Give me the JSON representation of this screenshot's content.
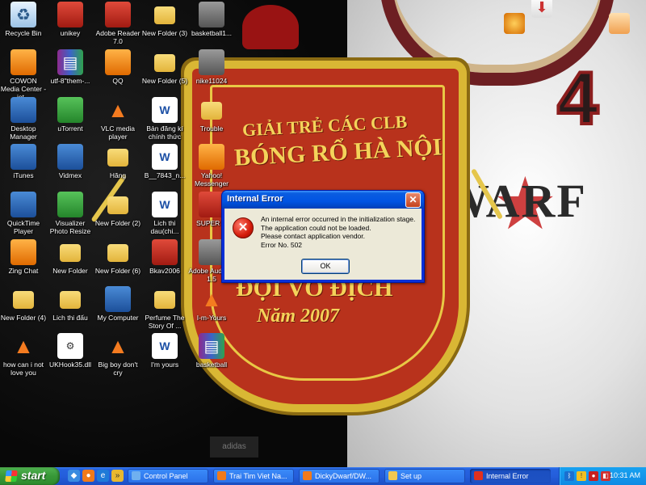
{
  "desktop_icons": [
    {
      "label": "Recycle Bin",
      "icon": "recycle-bin-icon"
    },
    {
      "label": "unikey",
      "icon": "unikey-icon"
    },
    {
      "label": "Adobe Reader 7.0",
      "icon": "adobe-reader-icon"
    },
    {
      "label": "New Folder (3)",
      "icon": "folder-icon"
    },
    {
      "label": "basketball1...",
      "icon": "image-file-icon"
    },
    {
      "label": "COWON Media Center - jet...",
      "icon": "cowon-icon"
    },
    {
      "label": "utf-8\"them-...",
      "icon": "winrar-icon"
    },
    {
      "label": "QQ",
      "icon": "qq-icon"
    },
    {
      "label": "New Folder (5)",
      "icon": "folder-icon"
    },
    {
      "label": "nike11024",
      "icon": "image-file-icon"
    },
    {
      "label": "Desktop Manager",
      "icon": "blackberry-icon"
    },
    {
      "label": "uTorrent",
      "icon": "utorrent-icon"
    },
    {
      "label": "VLC media player",
      "icon": "vlc-icon"
    },
    {
      "label": "Bản đăng kí chính thức",
      "icon": "word-doc-icon"
    },
    {
      "label": "Trouble",
      "icon": "folder-icon"
    },
    {
      "label": "iTunes",
      "icon": "itunes-icon"
    },
    {
      "label": "Vidmex",
      "icon": "vidmex-icon"
    },
    {
      "label": "Hăng",
      "icon": "folder-icon"
    },
    {
      "label": "B__7843_n...",
      "icon": "word-doc-icon"
    },
    {
      "label": "Yahoo! Messenger",
      "icon": "yahoo-messenger-icon"
    },
    {
      "label": "QuickTime Player",
      "icon": "quicktime-icon"
    },
    {
      "label": "Visualizer Photo Resize",
      "icon": "visualizer-icon"
    },
    {
      "label": "New Folder (2)",
      "icon": "folder-icon"
    },
    {
      "label": "Lich thi dau(chi...",
      "icon": "word-doc-icon"
    },
    {
      "label": "SUPER ©",
      "icon": "super-icon"
    },
    {
      "label": "Zing Chat",
      "icon": "zing-chat-icon"
    },
    {
      "label": "New Folder",
      "icon": "folder-icon"
    },
    {
      "label": "New Folder (6)",
      "icon": "folder-icon"
    },
    {
      "label": "Bkav2006",
      "icon": "bkav-icon"
    },
    {
      "label": "Adobe Audition 1.5",
      "icon": "adobe-audition-icon"
    },
    {
      "label": "New Folder (4)",
      "icon": "folder-icon"
    },
    {
      "label": "Lich thi đấu",
      "icon": "folder-icon"
    },
    {
      "label": "My Computer",
      "icon": "my-computer-icon"
    },
    {
      "label": "Perfume The Story Of ...",
      "icon": "folder-icon"
    },
    {
      "label": "I-m-Yours",
      "icon": "vlc-icon"
    },
    {
      "label": "how can i not love you",
      "icon": "vlc-icon"
    },
    {
      "label": "UKHook35.dll",
      "icon": "dll-file-icon"
    },
    {
      "label": "Big boy don't cry",
      "icon": "vlc-icon"
    },
    {
      "label": "I'm yours",
      "icon": "word-doc-icon"
    },
    {
      "label": "basketball",
      "icon": "winrar-icon"
    }
  ],
  "wallpaper": {
    "pennant_lines": [
      "GIẢI TRẺ CÁC CLB",
      "BÓNG RỔ HÀ NỘI",
      "ĐỘI VÔ ĐỊCH",
      "Năm 2007"
    ],
    "jersey_number": "4",
    "jersey_brand": "WARF"
  },
  "dialog": {
    "title": "Internal Error",
    "message_lines": [
      "An internal error occurred in the initialization stage.",
      "The application could not be loaded.",
      "Please contact application vendor.",
      "Error No. 502"
    ],
    "ok_label": "OK",
    "close_glyph": "✕"
  },
  "taskbar": {
    "start_label": "start",
    "tasks": [
      {
        "label": "Control Panel",
        "icon": "control-panel-icon",
        "active": false
      },
      {
        "label": "Trai Tim Viet Na...",
        "icon": "firefox-icon",
        "active": false
      },
      {
        "label": "DickyDwarf/DW...",
        "icon": "firefox-icon",
        "active": false
      },
      {
        "label": "Set up",
        "icon": "folder-icon",
        "active": false
      },
      {
        "label": "Internal Error",
        "icon": "error-icon",
        "active": true
      }
    ],
    "clock": "10:31 AM"
  },
  "colors": {
    "taskbar_blue": "#245edb",
    "start_green": "#389838",
    "dialog_body": "#ece9d8",
    "error_red": "#d41c0b"
  }
}
